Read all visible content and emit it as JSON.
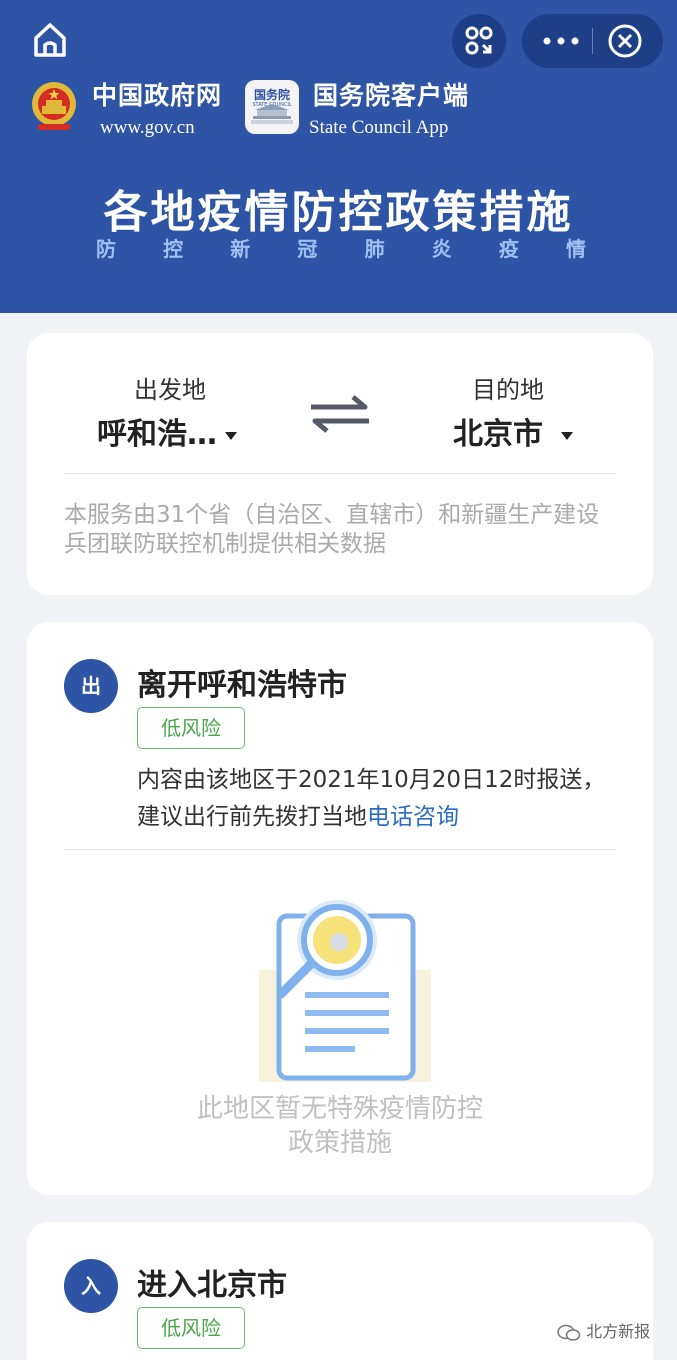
{
  "header": {
    "brand1": {
      "name": "中国政府网",
      "url": "www.gov.cn"
    },
    "brand2": {
      "icon_text": "国务院",
      "icon_subtext": "STATE COUNCIL",
      "name": "国务院客户端",
      "url": "State Council App"
    },
    "title": "各地疫情防控政策措施",
    "subtitle_chars": [
      "防",
      "控",
      "新",
      "冠",
      "肺",
      "炎",
      "疫",
      "情"
    ],
    "icons": {
      "home": "home-icon",
      "scan": "scan-icon",
      "more": "more-icon",
      "close": "close-icon"
    }
  },
  "route": {
    "from_label": "出发地",
    "from_value": "呼和浩…",
    "to_label": "目的地",
    "to_value": "北京市",
    "note": "本服务由31个省（自治区、直辖市）和新疆生产建设兵团联防联控机制提供相关数据"
  },
  "leave": {
    "badge": "出",
    "title": "离开呼和浩特市",
    "risk": "低风险",
    "report_text": "内容由该地区于2021年10月20日12时报送，建议出行前先拨打当地",
    "report_link": "电话咨询",
    "empty_text_line1": "此地区暂无特殊疫情防控",
    "empty_text_line2": "政策措施"
  },
  "enter": {
    "badge": "入",
    "title": "进入北京市",
    "risk": "低风险"
  },
  "watermark": "北方新报",
  "colors": {
    "header_bg": "#2d54a5",
    "accent": "#2d54a5",
    "risk_green": "#4aa84a",
    "link_blue": "#2d6cc6"
  }
}
